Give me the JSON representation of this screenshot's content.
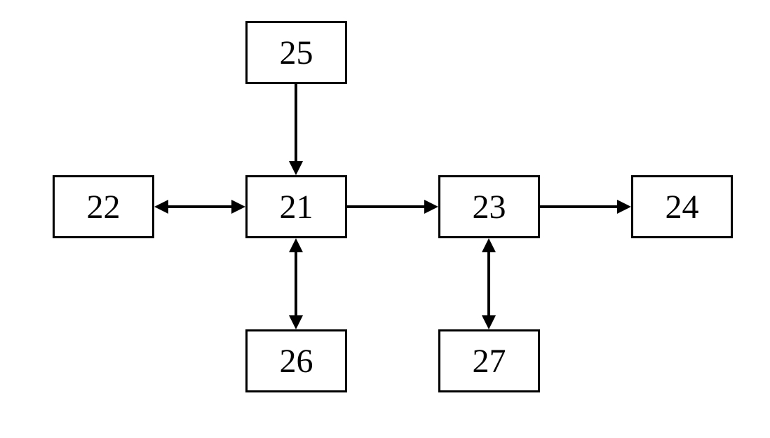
{
  "chart_data": {
    "type": "diagram",
    "nodes": [
      {
        "id": "21",
        "label": "21",
        "position": "center"
      },
      {
        "id": "22",
        "label": "22",
        "position": "left"
      },
      {
        "id": "23",
        "label": "23",
        "position": "right-center"
      },
      {
        "id": "24",
        "label": "24",
        "position": "far-right"
      },
      {
        "id": "25",
        "label": "25",
        "position": "top"
      },
      {
        "id": "26",
        "label": "26",
        "position": "bottom-left"
      },
      {
        "id": "27",
        "label": "27",
        "position": "bottom-right"
      }
    ],
    "edges": [
      {
        "from": "25",
        "to": "21",
        "direction": "unidirectional"
      },
      {
        "from": "22",
        "to": "21",
        "direction": "bidirectional"
      },
      {
        "from": "21",
        "to": "23",
        "direction": "unidirectional"
      },
      {
        "from": "23",
        "to": "24",
        "direction": "unidirectional"
      },
      {
        "from": "21",
        "to": "26",
        "direction": "bidirectional"
      },
      {
        "from": "23",
        "to": "27",
        "direction": "bidirectional"
      }
    ]
  },
  "boxes": {
    "b21": "21",
    "b22": "22",
    "b23": "23",
    "b24": "24",
    "b25": "25",
    "b26": "26",
    "b27": "27"
  }
}
